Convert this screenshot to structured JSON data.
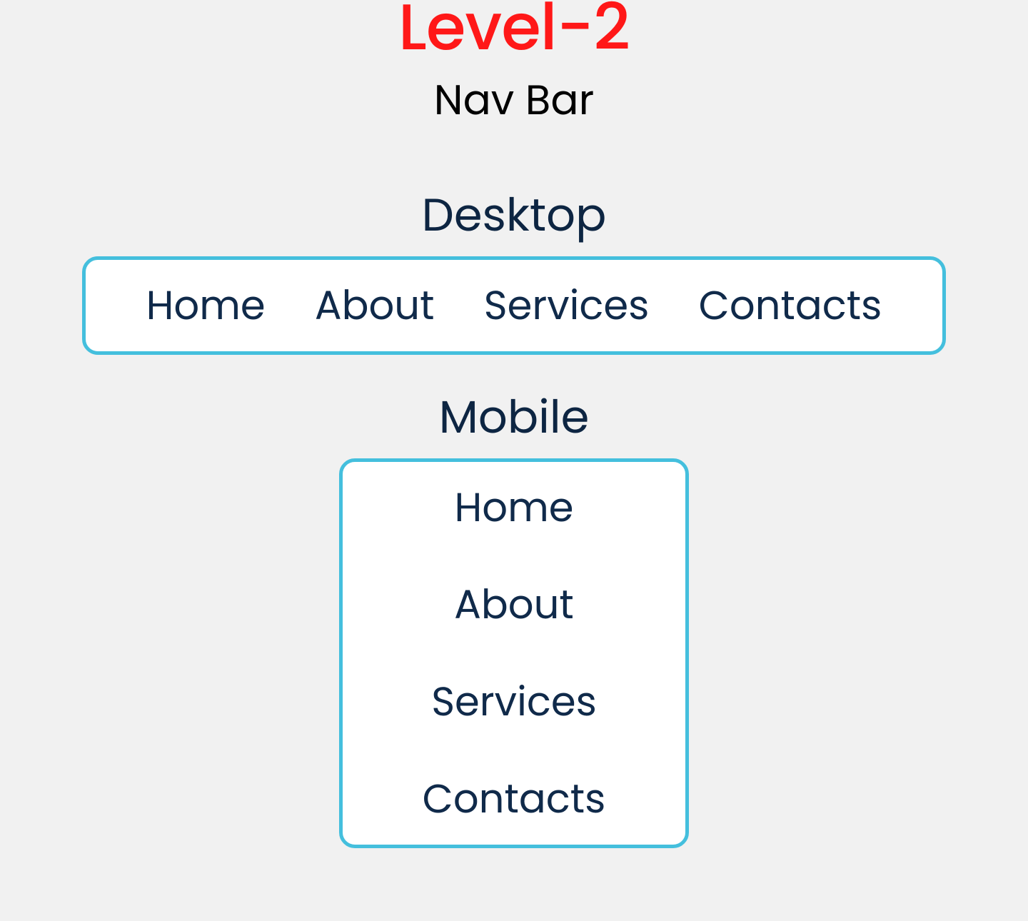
{
  "header": {
    "title": "Level-2",
    "subtitle": "Nav Bar"
  },
  "sections": {
    "desktop_heading": "Desktop",
    "mobile_heading": "Mobile"
  },
  "nav": {
    "items": [
      {
        "label": "Home"
      },
      {
        "label": "About"
      },
      {
        "label": "Services"
      },
      {
        "label": "Contacts"
      }
    ]
  }
}
